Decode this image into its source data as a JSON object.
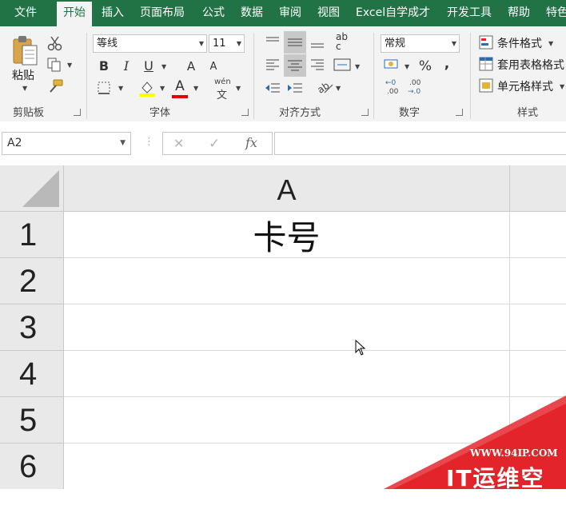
{
  "menu": {
    "tabs": [
      "文件",
      "开始",
      "插入",
      "页面布局",
      "公式",
      "数据",
      "审阅",
      "视图",
      "Excel自学成才",
      "开发工具",
      "帮助",
      "特色"
    ],
    "active_index": 1
  },
  "ribbon": {
    "clipboard": {
      "paste_label": "粘贴",
      "group_label": "剪贴板"
    },
    "font": {
      "font_name": "等线",
      "font_size": "11",
      "bold": "B",
      "italic": "I",
      "underline": "U",
      "grow": "A",
      "shrink": "A",
      "font_color_letter": "A",
      "phonetic_top": "wén",
      "phonetic_bottom": "文",
      "group_label": "字体"
    },
    "alignment": {
      "wrap_top": "ab",
      "wrap_bottom": "c",
      "group_label": "对齐方式"
    },
    "number": {
      "format": "常规",
      "percent": "%",
      "comma": ",",
      "inc_decimal_top": "←0",
      "inc_decimal_bottom": ".00",
      "dec_decimal_top": ".00",
      "dec_decimal_bottom": "→.0",
      "group_label": "数字"
    },
    "styles": {
      "conditional": "条件格式",
      "table_format": "套用表格格式",
      "cell_style": "单元格样式",
      "group_label": "样式"
    }
  },
  "formula_bar": {
    "name_box": "A2",
    "cancel": "✕",
    "enter": "✓",
    "fx": "fx",
    "value": ""
  },
  "sheet": {
    "columns": [
      "A"
    ],
    "rows": [
      "1",
      "2",
      "3",
      "4",
      "5",
      "6"
    ],
    "cells": {
      "A1": "卡号"
    }
  },
  "watermark": {
    "url": "WWW.94IP.COM",
    "text": "IT运维空间"
  },
  "colors": {
    "brand": "#217346",
    "ribbon_bg": "#f3f3f3",
    "header_bg": "#e9e9e9",
    "watermark_red": "#e3242b"
  }
}
